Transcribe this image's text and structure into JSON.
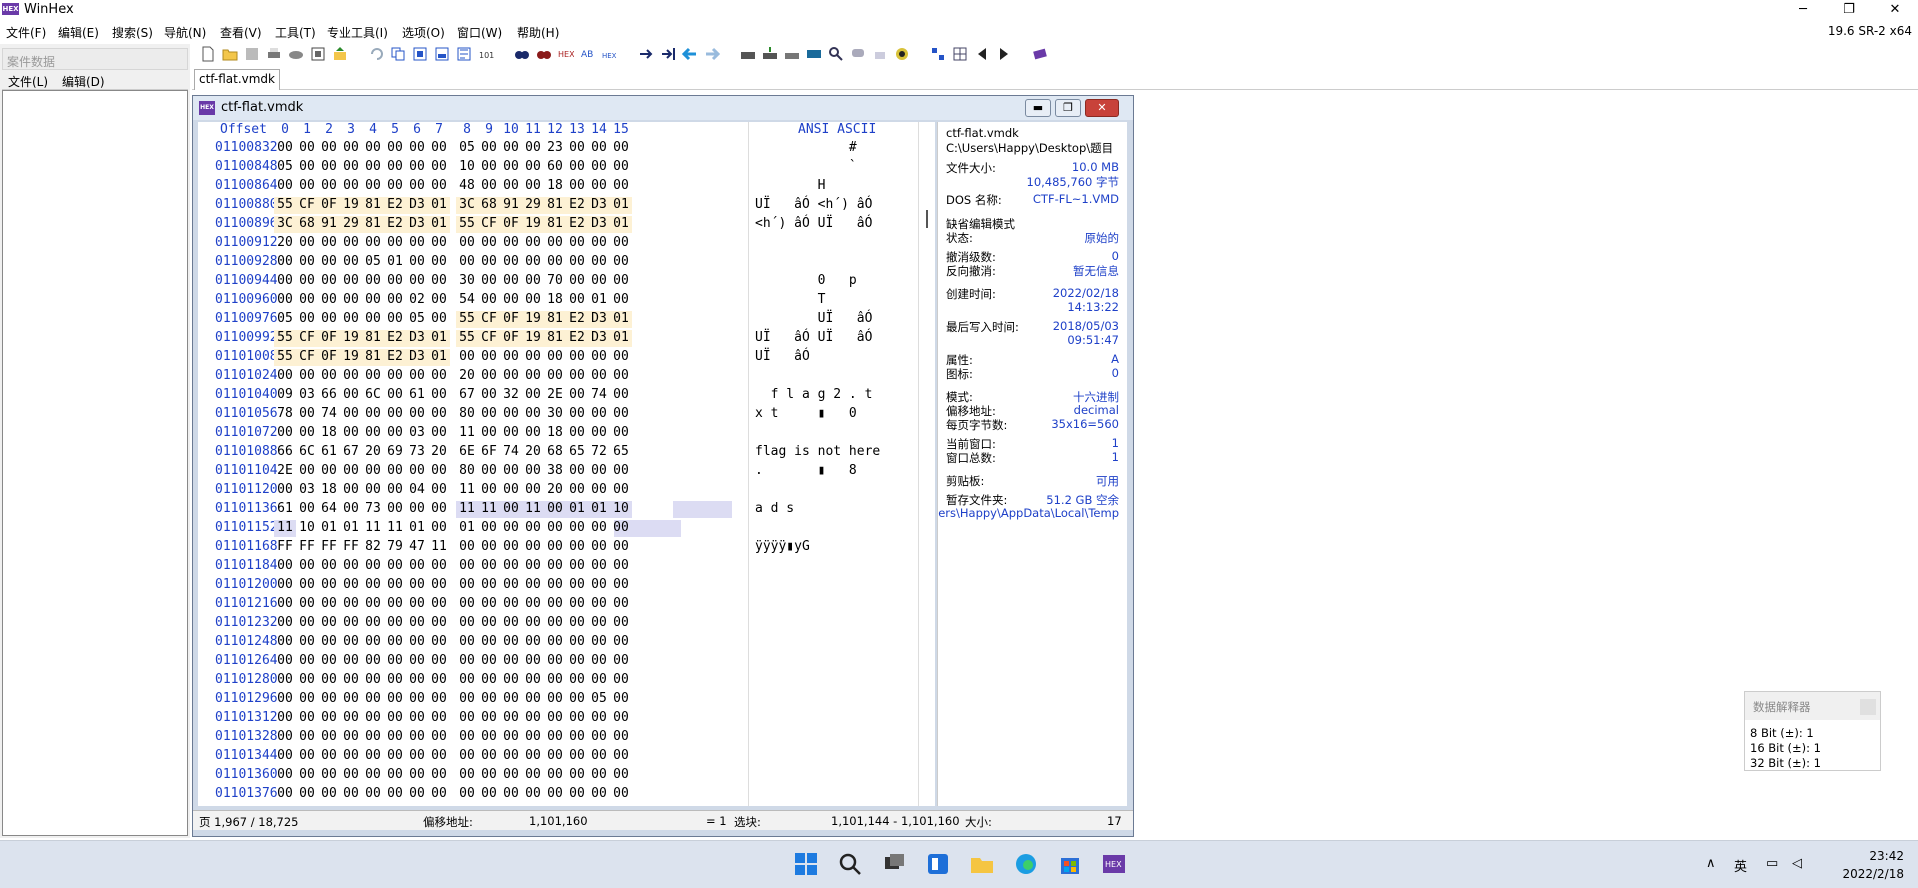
{
  "app": {
    "title": "WinHex",
    "icon_label": "HEX",
    "version": "19.6 SR-2 x64"
  },
  "window_controls": {
    "minimize": "─",
    "maximize": "❐",
    "close": "✕"
  },
  "menu": [
    "文件(F)",
    "编辑(E)",
    "搜索(S)",
    "导航(N)",
    "查看(V)",
    "工具(T)",
    "专业工具(I)",
    "选项(O)",
    "窗口(W)",
    "帮助(H)"
  ],
  "left_panel": {
    "title": "案件数据",
    "menu": [
      "文件(L)",
      "编辑(D)"
    ]
  },
  "tab": {
    "label": "ctf-flat.vmdk"
  },
  "editor": {
    "title": "ctf-flat.vmdk",
    "header": {
      "offset": "Offset",
      "cols": [
        "0",
        "1",
        "2",
        "3",
        "4",
        "5",
        "6",
        "7",
        "8",
        "9",
        "10",
        "11",
        "12",
        "13",
        "14",
        "15"
      ],
      "ascii": "ANSI ASCII"
    },
    "rows": [
      {
        "offset": "01100832",
        "bytes": [
          "00",
          "00",
          "00",
          "00",
          "00",
          "00",
          "00",
          "00",
          "05",
          "00",
          "00",
          "00",
          "23",
          "00",
          "00",
          "00"
        ],
        "ascii": "            #   "
      },
      {
        "offset": "01100848",
        "bytes": [
          "05",
          "00",
          "00",
          "00",
          "00",
          "00",
          "00",
          "00",
          "10",
          "00",
          "00",
          "00",
          "60",
          "00",
          "00",
          "00"
        ],
        "ascii": "            `   "
      },
      {
        "offset": "01100864",
        "bytes": [
          "00",
          "00",
          "00",
          "00",
          "00",
          "00",
          "00",
          "00",
          "48",
          "00",
          "00",
          "00",
          "18",
          "00",
          "00",
          "00"
        ],
        "ascii": "        H       "
      },
      {
        "offset": "01100880",
        "bytes": [
          "55",
          "CF",
          "0F",
          "19",
          "81",
          "E2",
          "D3",
          "01",
          "3C",
          "68",
          "91",
          "29",
          "81",
          "E2",
          "D3",
          "01"
        ],
        "ascii": "UÏ   âÓ <h´) âÓ "
      },
      {
        "offset": "01100896",
        "bytes": [
          "3C",
          "68",
          "91",
          "29",
          "81",
          "E2",
          "D3",
          "01",
          "55",
          "CF",
          "0F",
          "19",
          "81",
          "E2",
          "D3",
          "01"
        ],
        "ascii": "<h´) âÓ UÏ   âÓ "
      },
      {
        "offset": "01100912",
        "bytes": [
          "20",
          "00",
          "00",
          "00",
          "00",
          "00",
          "00",
          "00",
          "00",
          "00",
          "00",
          "00",
          "00",
          "00",
          "00",
          "00"
        ],
        "ascii": "                "
      },
      {
        "offset": "01100928",
        "bytes": [
          "00",
          "00",
          "00",
          "00",
          "05",
          "01",
          "00",
          "00",
          "00",
          "00",
          "00",
          "00",
          "00",
          "00",
          "00",
          "00"
        ],
        "ascii": "                "
      },
      {
        "offset": "01100944",
        "bytes": [
          "00",
          "00",
          "00",
          "00",
          "00",
          "00",
          "00",
          "00",
          "30",
          "00",
          "00",
          "00",
          "70",
          "00",
          "00",
          "00"
        ],
        "ascii": "        0   p   "
      },
      {
        "offset": "01100960",
        "bytes": [
          "00",
          "00",
          "00",
          "00",
          "00",
          "00",
          "02",
          "00",
          "54",
          "00",
          "00",
          "00",
          "18",
          "00",
          "01",
          "00"
        ],
        "ascii": "        T       "
      },
      {
        "offset": "01100976",
        "bytes": [
          "05",
          "00",
          "00",
          "00",
          "00",
          "00",
          "05",
          "00",
          "55",
          "CF",
          "0F",
          "19",
          "81",
          "E2",
          "D3",
          "01"
        ],
        "ascii": "        UÏ   âÓ "
      },
      {
        "offset": "01100992",
        "bytes": [
          "55",
          "CF",
          "0F",
          "19",
          "81",
          "E2",
          "D3",
          "01",
          "55",
          "CF",
          "0F",
          "19",
          "81",
          "E2",
          "D3",
          "01"
        ],
        "ascii": "UÏ   âÓ UÏ   âÓ "
      },
      {
        "offset": "01101008",
        "bytes": [
          "55",
          "CF",
          "0F",
          "19",
          "81",
          "E2",
          "D3",
          "01",
          "00",
          "00",
          "00",
          "00",
          "00",
          "00",
          "00",
          "00"
        ],
        "ascii": "UÏ   âÓ         "
      },
      {
        "offset": "01101024",
        "bytes": [
          "00",
          "00",
          "00",
          "00",
          "00",
          "00",
          "00",
          "00",
          "20",
          "00",
          "00",
          "00",
          "00",
          "00",
          "00",
          "00"
        ],
        "ascii": "                "
      },
      {
        "offset": "01101040",
        "bytes": [
          "09",
          "03",
          "66",
          "00",
          "6C",
          "00",
          "61",
          "00",
          "67",
          "00",
          "32",
          "00",
          "2E",
          "00",
          "74",
          "00"
        ],
        "ascii": "  f l a g 2 . t "
      },
      {
        "offset": "01101056",
        "bytes": [
          "78",
          "00",
          "74",
          "00",
          "00",
          "00",
          "00",
          "00",
          "80",
          "00",
          "00",
          "00",
          "30",
          "00",
          "00",
          "00"
        ],
        "ascii": "x t     ▮   0   "
      },
      {
        "offset": "01101072",
        "bytes": [
          "00",
          "00",
          "18",
          "00",
          "00",
          "00",
          "03",
          "00",
          "11",
          "00",
          "00",
          "00",
          "18",
          "00",
          "00",
          "00"
        ],
        "ascii": "                "
      },
      {
        "offset": "01101088",
        "bytes": [
          "66",
          "6C",
          "61",
          "67",
          "20",
          "69",
          "73",
          "20",
          "6E",
          "6F",
          "74",
          "20",
          "68",
          "65",
          "72",
          "65"
        ],
        "ascii": "flag is not here"
      },
      {
        "offset": "01101104",
        "bytes": [
          "2E",
          "00",
          "00",
          "00",
          "00",
          "00",
          "00",
          "00",
          "80",
          "00",
          "00",
          "00",
          "38",
          "00",
          "00",
          "00"
        ],
        "ascii": ".       ▮   8   "
      },
      {
        "offset": "01101120",
        "bytes": [
          "00",
          "03",
          "18",
          "00",
          "00",
          "00",
          "04",
          "00",
          "11",
          "00",
          "00",
          "00",
          "20",
          "00",
          "00",
          "00"
        ],
        "ascii": "                "
      },
      {
        "offset": "01101136",
        "bytes": [
          "61",
          "00",
          "64",
          "00",
          "73",
          "00",
          "00",
          "00",
          "11",
          "11",
          "00",
          "11",
          "00",
          "01",
          "01",
          "10"
        ],
        "ascii": "a d s           "
      },
      {
        "offset": "01101152",
        "bytes": [
          "11",
          "10",
          "01",
          "01",
          "11",
          "11",
          "01",
          "00",
          "01",
          "00",
          "00",
          "00",
          "00",
          "00",
          "00",
          "00"
        ],
        "ascii": "                "
      },
      {
        "offset": "01101168",
        "bytes": [
          "FF",
          "FF",
          "FF",
          "FF",
          "82",
          "79",
          "47",
          "11",
          "00",
          "00",
          "00",
          "00",
          "00",
          "00",
          "00",
          "00"
        ],
        "ascii": "ÿÿÿÿ▮yG         "
      },
      {
        "offset": "01101184",
        "bytes": [
          "00",
          "00",
          "00",
          "00",
          "00",
          "00",
          "00",
          "00",
          "00",
          "00",
          "00",
          "00",
          "00",
          "00",
          "00",
          "00"
        ],
        "ascii": ""
      },
      {
        "offset": "01101200",
        "bytes": [
          "00",
          "00",
          "00",
          "00",
          "00",
          "00",
          "00",
          "00",
          "00",
          "00",
          "00",
          "00",
          "00",
          "00",
          "00",
          "00"
        ],
        "ascii": ""
      },
      {
        "offset": "01101216",
        "bytes": [
          "00",
          "00",
          "00",
          "00",
          "00",
          "00",
          "00",
          "00",
          "00",
          "00",
          "00",
          "00",
          "00",
          "00",
          "00",
          "00"
        ],
        "ascii": ""
      },
      {
        "offset": "01101232",
        "bytes": [
          "00",
          "00",
          "00",
          "00",
          "00",
          "00",
          "00",
          "00",
          "00",
          "00",
          "00",
          "00",
          "00",
          "00",
          "00",
          "00"
        ],
        "ascii": ""
      },
      {
        "offset": "01101248",
        "bytes": [
          "00",
          "00",
          "00",
          "00",
          "00",
          "00",
          "00",
          "00",
          "00",
          "00",
          "00",
          "00",
          "00",
          "00",
          "00",
          "00"
        ],
        "ascii": ""
      },
      {
        "offset": "01101264",
        "bytes": [
          "00",
          "00",
          "00",
          "00",
          "00",
          "00",
          "00",
          "00",
          "00",
          "00",
          "00",
          "00",
          "00",
          "00",
          "00",
          "00"
        ],
        "ascii": ""
      },
      {
        "offset": "01101280",
        "bytes": [
          "00",
          "00",
          "00",
          "00",
          "00",
          "00",
          "00",
          "00",
          "00",
          "00",
          "00",
          "00",
          "00",
          "00",
          "00",
          "00"
        ],
        "ascii": ""
      },
      {
        "offset": "01101296",
        "bytes": [
          "00",
          "00",
          "00",
          "00",
          "00",
          "00",
          "00",
          "00",
          "00",
          "00",
          "00",
          "00",
          "00",
          "00",
          "05",
          "00"
        ],
        "ascii": ""
      },
      {
        "offset": "01101312",
        "bytes": [
          "00",
          "00",
          "00",
          "00",
          "00",
          "00",
          "00",
          "00",
          "00",
          "00",
          "00",
          "00",
          "00",
          "00",
          "00",
          "00"
        ],
        "ascii": ""
      },
      {
        "offset": "01101328",
        "bytes": [
          "00",
          "00",
          "00",
          "00",
          "00",
          "00",
          "00",
          "00",
          "00",
          "00",
          "00",
          "00",
          "00",
          "00",
          "00",
          "00"
        ],
        "ascii": ""
      },
      {
        "offset": "01101344",
        "bytes": [
          "00",
          "00",
          "00",
          "00",
          "00",
          "00",
          "00",
          "00",
          "00",
          "00",
          "00",
          "00",
          "00",
          "00",
          "00",
          "00"
        ],
        "ascii": ""
      },
      {
        "offset": "01101360",
        "bytes": [
          "00",
          "00",
          "00",
          "00",
          "00",
          "00",
          "00",
          "00",
          "00",
          "00",
          "00",
          "00",
          "00",
          "00",
          "00",
          "00"
        ],
        "ascii": ""
      },
      {
        "offset": "01101376",
        "bytes": [
          "00",
          "00",
          "00",
          "00",
          "00",
          "00",
          "00",
          "00",
          "00",
          "00",
          "00",
          "00",
          "00",
          "00",
          "00",
          "00"
        ],
        "ascii": ""
      }
    ],
    "info": [
      {
        "label": "ctf-flat.vmdk",
        "value": ""
      },
      {
        "label": "C:\\Users\\Happy\\Desktop\\题目",
        "value": ""
      },
      {
        "label": "文件大小:",
        "value": "10.0 MB"
      },
      {
        "label": "",
        "value": "10,485,760 字节"
      },
      {
        "label": "DOS 名称:",
        "value": "CTF-FL~1.VMD"
      },
      {
        "label": "缺省编辑模式",
        "value": ""
      },
      {
        "label": "状态:",
        "value": "原始的"
      },
      {
        "label": "撤消级数:",
        "value": "0"
      },
      {
        "label": "反向撤消:",
        "value": "暂无信息"
      },
      {
        "label": "创建时间:",
        "value": "2022/02/18"
      },
      {
        "label": "",
        "value": "14:13:22"
      },
      {
        "label": "最后写入时间:",
        "value": "2018/05/03"
      },
      {
        "label": "",
        "value": "09:51:47"
      },
      {
        "label": "属性:",
        "value": "A"
      },
      {
        "label": "图标:",
        "value": "0"
      },
      {
        "label": "模式:",
        "value": "十六进制"
      },
      {
        "label": "偏移地址:",
        "value": "decimal"
      },
      {
        "label": "每页字节数:",
        "value": "35x16=560"
      },
      {
        "label": "当前窗口:",
        "value": "1"
      },
      {
        "label": "窗口总数:",
        "value": "1"
      },
      {
        "label": "剪贴板:",
        "value": "可用"
      },
      {
        "label": "暂存文件夹:",
        "value": "51.2 GB 空余"
      },
      {
        "label": "",
        "value": "ers\\Happy\\AppData\\Local\\Temp"
      }
    ],
    "status": {
      "page": "页 1,967 / 18,725",
      "offset_label": "偏移地址:",
      "offset_value": "1,101,160",
      "eq": "= 1",
      "block_label": "选块:",
      "block_value": "1,101,144 - 1,101,160",
      "size_label": "大小:",
      "size_value": "17"
    }
  },
  "data_interpreter": {
    "title": "数据解释器",
    "lines": [
      "8 Bit (±): 1",
      "16 Bit (±): 1",
      "32 Bit (±): 1"
    ]
  },
  "taskbar": {
    "time": "23:42",
    "date": "2022/2/18",
    "ime": "英"
  }
}
